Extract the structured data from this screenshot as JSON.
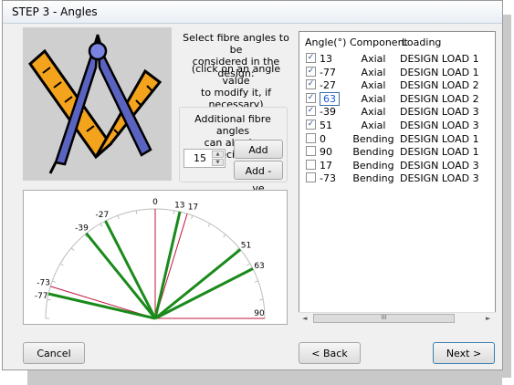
{
  "window": {
    "title": "STEP 3 - Angles"
  },
  "instructions": {
    "select_line1": "Select fibre angles to be",
    "select_line2": "considered in the design:",
    "click_line1": "(click on an angle value",
    "click_line2": "to modify it, if necessary)"
  },
  "additional": {
    "label_line1": "Additional fibre angles",
    "label_line2": "can also be specified:",
    "spin_value": "15",
    "add_pos_label": "Add +ve",
    "add_neg_label": "Add -ve"
  },
  "listview": {
    "columns": [
      "Angle(°)",
      "Component",
      "Loading"
    ],
    "rows": [
      {
        "checked": true,
        "angle": "13",
        "component": "Axial",
        "loading": "DESIGN LOAD 1"
      },
      {
        "checked": true,
        "angle": "-77",
        "component": "Axial",
        "loading": "DESIGN LOAD 1"
      },
      {
        "checked": true,
        "angle": "-27",
        "component": "Axial",
        "loading": "DESIGN LOAD 2"
      },
      {
        "checked": true,
        "angle": "63",
        "component": "Axial",
        "loading": "DESIGN LOAD 2",
        "editing": true
      },
      {
        "checked": true,
        "angle": "-39",
        "component": "Axial",
        "loading": "DESIGN LOAD 3"
      },
      {
        "checked": true,
        "angle": "51",
        "component": "Axial",
        "loading": "DESIGN LOAD 3"
      },
      {
        "checked": false,
        "angle": "0",
        "component": "Bending",
        "loading": "DESIGN LOAD 1"
      },
      {
        "checked": false,
        "angle": "90",
        "component": "Bending",
        "loading": "DESIGN LOAD 1"
      },
      {
        "checked": false,
        "angle": "17",
        "component": "Bending",
        "loading": "DESIGN LOAD 3"
      },
      {
        "checked": false,
        "angle": "-73",
        "component": "Bending",
        "loading": "DESIGN LOAD 3"
      }
    ],
    "scroll_thumb_glyph": "III"
  },
  "angle_chart": {
    "labels": [
      "0",
      "13",
      "17",
      "-27",
      "-39",
      "51",
      "63",
      "-73",
      "-77",
      "90"
    ],
    "selected_angles": [
      13,
      -77,
      -27,
      63,
      -39,
      51
    ],
    "other_angles": [
      0,
      90,
      17,
      -73
    ],
    "selected_color": "#1a8a1a",
    "other_color": "#c0143c"
  },
  "buttons": {
    "cancel": "Cancel",
    "back": "< Back",
    "next": "Next >"
  },
  "icons": [
    "compass-square-icon",
    "checkbox-icon",
    "spin-up-icon",
    "spin-down-icon",
    "scroll-left-icon",
    "scroll-right-icon"
  ]
}
